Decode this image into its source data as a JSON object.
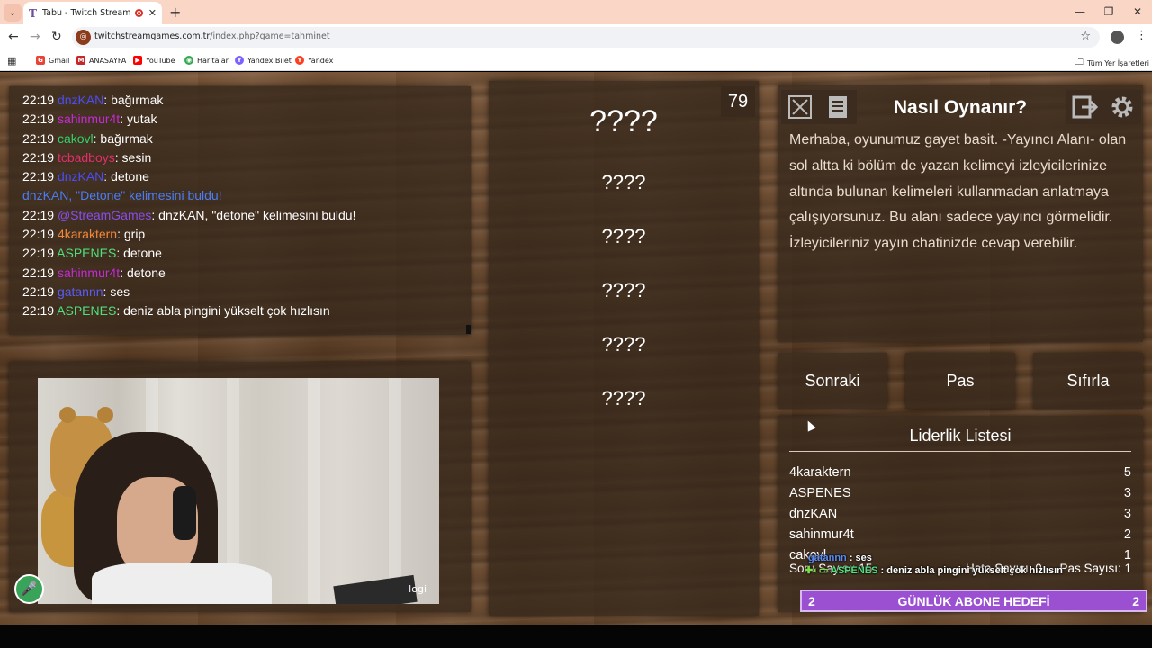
{
  "browser": {
    "tab_title": "Tabu - Twitch Stream Game",
    "tab_favicon": "T",
    "url_host": "twitchstreamgames.com.tr",
    "url_path": "/index.php?game=tahminet",
    "bookmarks": [
      {
        "label": "Gmail",
        "icon": "gmail-icon",
        "color": "#ea4335",
        "glyph": "G"
      },
      {
        "label": "ANASAYFA",
        "icon": "anasayfa-icon",
        "color": "#c62828",
        "glyph": "M"
      },
      {
        "label": "YouTube",
        "icon": "youtube-icon",
        "color": "#ff0000",
        "glyph": "▶"
      },
      {
        "label": "Haritalar",
        "icon": "maps-icon",
        "color": "#34a853",
        "glyph": "◉"
      },
      {
        "label": "Yandex.Bilet",
        "icon": "yandex-bilet-icon",
        "color": "#7b61ff",
        "glyph": "Y"
      },
      {
        "label": "Yandex",
        "icon": "yandex-icon",
        "color": "#fc3f1d",
        "glyph": "Y"
      }
    ],
    "all_bookmarks": "Tüm Yer İşaretleri"
  },
  "chat": [
    {
      "time": "22:19",
      "user": "dnzKAN",
      "user_color": "#4a4df5",
      "text": ": bağırmak"
    },
    {
      "time": "22:19",
      "user": "sahinmur4t",
      "user_color": "#c62bd6",
      "text": ": yutak"
    },
    {
      "time": "22:19",
      "user": "cakovl",
      "user_color": "#33d36a",
      "text": ": bağırmak"
    },
    {
      "time": "22:19",
      "user": "tcbadboys",
      "user_color": "#e0306a",
      "text": ": sesin"
    },
    {
      "time": "22:19",
      "user": "dnzKAN",
      "user_color": "#4a4df5",
      "text": ": detone"
    },
    {
      "system": true,
      "text": "dnzKAN, \"Detone\" kelimesini buldu!"
    },
    {
      "time": "22:19",
      "user": "@StreamGames",
      "user_color": "#8a4cf0",
      "text": ": dnzKAN, \"detone\" kelimesini buldu!"
    },
    {
      "time": "22:19",
      "user": "4karaktern",
      "user_color": "#f0873a",
      "text": ": grip"
    },
    {
      "time": "22:19",
      "user": "ASPENES",
      "user_color": "#4fe07b",
      "text": ": detone"
    },
    {
      "time": "22:19",
      "user": "sahinmur4t",
      "user_color": "#c62bd6",
      "text": ": detone"
    },
    {
      "time": "22:19",
      "user": "gatannn",
      "user_color": "#5a5cf5",
      "text": ": ses"
    },
    {
      "time": "22:19",
      "user": "ASPENES",
      "user_color": "#4fe07b",
      "text": ": deniz abla pingini yükselt çok hızlısın"
    }
  ],
  "cam": {
    "logo": "logi"
  },
  "game": {
    "timer": "79",
    "main_word": "????",
    "taboo_words": [
      "????",
      "????",
      "????",
      "????",
      "????"
    ]
  },
  "howto": {
    "title": "Nasıl Oynanır?",
    "text": "Merhaba, oyunumuz gayet basit. -Yayıncı Alanı- olan sol altta ki bölüm de yazan kelimeyi izleyicilerinize altında bulunan kelimeleri kullanmadan anlatmaya çalışıyorsunuz. Bu alanı sadece yayıncı görmelidir. İzleyicileriniz yayın chatinizde cevap verebilir."
  },
  "buttons": {
    "next": "Sonraki",
    "pass": "Pas",
    "reset": "Sıfırla"
  },
  "leaderboard": {
    "title": "Liderlik Listesi",
    "rows": [
      {
        "name": "4karaktern",
        "score": "5"
      },
      {
        "name": "ASPENES",
        "score": "3"
      },
      {
        "name": "dnzKAN",
        "score": "3"
      },
      {
        "name": "sahinmur4t",
        "score": "2"
      },
      {
        "name": "cakovl",
        "score": "1"
      }
    ],
    "question_count": "Soru Sayısı: 15",
    "error_count": "Hata Sayısı: 0",
    "pass_count": "Pas Sayısı: 1"
  },
  "stream_overlay": {
    "line1_user": "gatannn",
    "line1_text": " : ses",
    "line2_user": "ASPENES",
    "line2_text": " : deniz abla pingini yükselt çok hızlısın",
    "goal_left": "2",
    "goal_label": "GÜNLÜK ABONE HEDEFİ",
    "goal_right": "2"
  }
}
